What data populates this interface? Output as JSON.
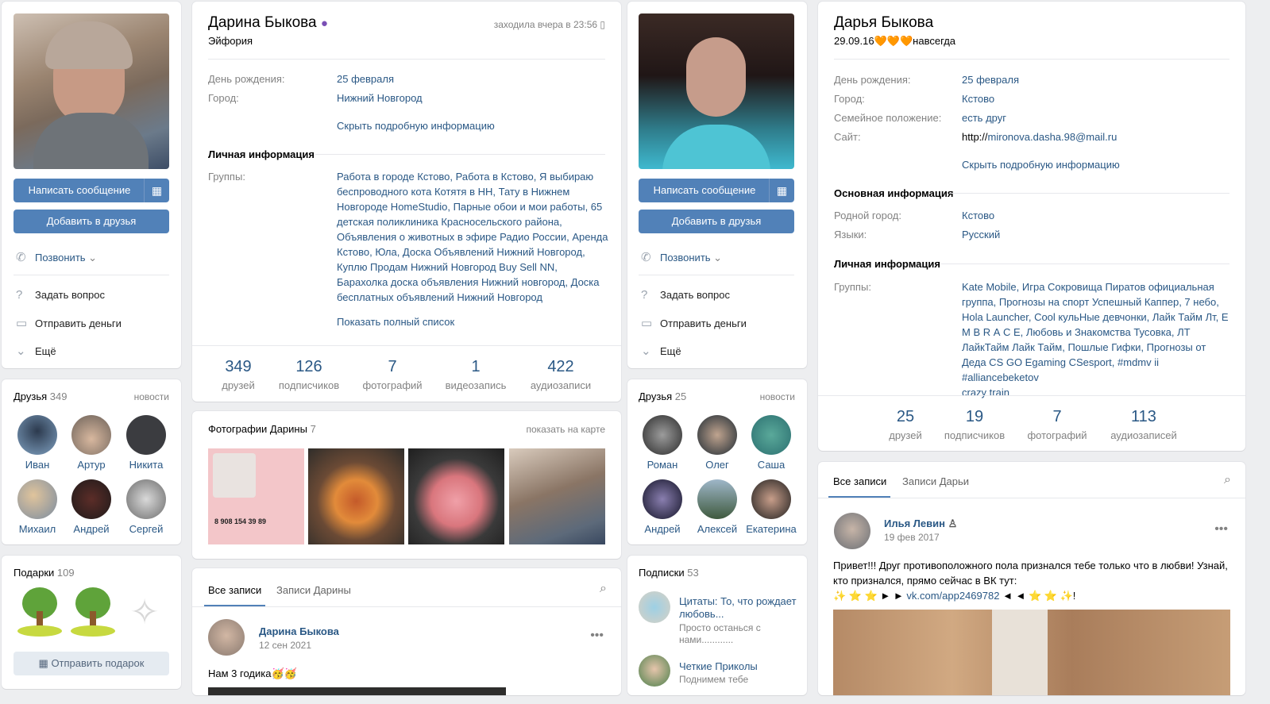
{
  "p1": {
    "write_btn": "Написать сообщение",
    "add_btn": "Добавить в друзья",
    "call": "Позвонить",
    "ask": "Задать вопрос",
    "money": "Отправить деньги",
    "more": "Ещё",
    "friends": {
      "title": "Друзья",
      "count": "349",
      "news": "новости",
      "names": [
        "Иван",
        "Артур",
        "Никита",
        "Михаил",
        "Андрей",
        "Сергей"
      ]
    },
    "gifts": {
      "title": "Подарки",
      "count": "109",
      "send": "Отправить подарок"
    },
    "name": "Дарина Быкова",
    "status": "Эйфория",
    "online": "заходила вчера в 23:56",
    "info": {
      "bday_l": "День рождения:",
      "bday_v": "25 февраля",
      "city_l": "Город:",
      "city_v": "Нижний Новгород",
      "hide": "Скрыть подробную информацию"
    },
    "personal": "Личная информация",
    "groups_l": "Группы:",
    "groups_lines": [
      "Работа в городе Кстово, Работа в Кстово, Я выбираю",
      "беспроводного кота Котятя в НН, Тату в Нижнем",
      "Новгороде HomeStudio, Парные обои и мои работы, 65",
      "детская поликлиника Красносельского района,",
      "Объявления о животных в эфире Радио России, Аренда",
      "Кстово, Юла, Доска Объявлений Нижний Новгород,",
      "Куплю Продам Нижний Новгород Buy Sell NN,",
      "Барахолка доска объявления Нижний новгород, Доска",
      "бесплатных объявлений Нижний Новгород"
    ],
    "show_full": "Показать полный список",
    "stats": [
      {
        "n": "349",
        "t": "друзей"
      },
      {
        "n": "126",
        "t": "подписчиков"
      },
      {
        "n": "7",
        "t": "фотографий"
      },
      {
        "n": "1",
        "t": "видеозапись"
      },
      {
        "n": "422",
        "t": "аудиозаписи"
      }
    ],
    "photos": {
      "title": "Фотографии Дарины",
      "count": "7",
      "map": "показать на карте",
      "ad_phone": "8 908 154 39 89"
    },
    "wall": {
      "tab_all": "Все записи",
      "tab_own": "Записи Дарины",
      "author": "Дарина Быкова",
      "date": "12 сен 2021",
      "text": "Нам 3 годика🥳🥳"
    }
  },
  "p2": {
    "write_btn": "Написать сообщение",
    "add_btn": "Добавить в друзья",
    "call": "Позвонить",
    "ask": "Задать вопрос",
    "money": "Отправить деньги",
    "more": "Ещё",
    "friends": {
      "title": "Друзья",
      "count": "25",
      "news": "новости",
      "names": [
        "Роман",
        "Олег",
        "Саша",
        "Андрей",
        "Алексей",
        "Екатерина"
      ]
    },
    "subs": {
      "title": "Подписки",
      "count": "53",
      "items": [
        {
          "name1": "Цитаты: То, что рождает",
          "name2": "любовь...",
          "desc1": "Просто останься с",
          "desc2": "нами............"
        },
        {
          "name1": "Четкие Приколы",
          "desc1": "Поднимем тебе"
        }
      ]
    },
    "name": "Дарья Быкова",
    "status": "29.09.16🧡🧡🧡навсегда",
    "info": {
      "bday_l": "День рождения:",
      "bday_v": "25 февраля",
      "city_l": "Город:",
      "city_v": "Кстово",
      "fam_l": "Семейное положение:",
      "fam_v": "есть друг",
      "site_l": "Сайт:",
      "site_v1": "http://",
      "site_v2": "mironova.dasha.98@mail.ru",
      "hide": "Скрыть подробную информацию"
    },
    "main": "Основная информация",
    "home_l": "Родной город:",
    "home_v": "Кстово",
    "lang_l": "Языки:",
    "lang_v": "Русский",
    "personal": "Личная информация",
    "groups_l": "Группы:",
    "groups_lines": [
      "Kate Mobile, Игра Сокровища Пиратов официальная",
      "группа, Прогнозы на спорт Успешный Каппер, 7 небо,",
      "Hola Launcher, Cool кульНые девчонки, Лайк Тайм Лт, Е",
      "М В R А С Е, Любовь и Знакомства Тусовка, ЛТ",
      "ЛайкТайм Лайк Тайм, Пошлые Гифки, Прогнозы от",
      "Деда CS GO Egaming CSesport, #mdmv ii #alliancebeketov",
      "crazy train"
    ],
    "stats": [
      {
        "n": "25",
        "t": "друзей"
      },
      {
        "n": "19",
        "t": "подписчиков"
      },
      {
        "n": "7",
        "t": "фотографий"
      },
      {
        "n": "113",
        "t": "аудиозаписей"
      }
    ],
    "wall": {
      "tab_all": "Все записи",
      "tab_own": "Записи Дарьи",
      "author": "Илья Левин",
      "date": "19 фев 2017",
      "text1": "Привет!!! Друг противоположного пола признался тебе только что в любви! Узнай,",
      "text2": "кто признался, прямо сейчас в ВК тут:",
      "text3_pre": "✨ ⭐ ⭐ ► ► ",
      "text3_link": "vk.com/app2469782",
      "text3_post": " ◄ ◄ ⭐ ⭐ ✨!"
    }
  },
  "colors": {
    "accent": "#5181b8",
    "link": "#2a5885",
    "bg": "#edeef0"
  }
}
